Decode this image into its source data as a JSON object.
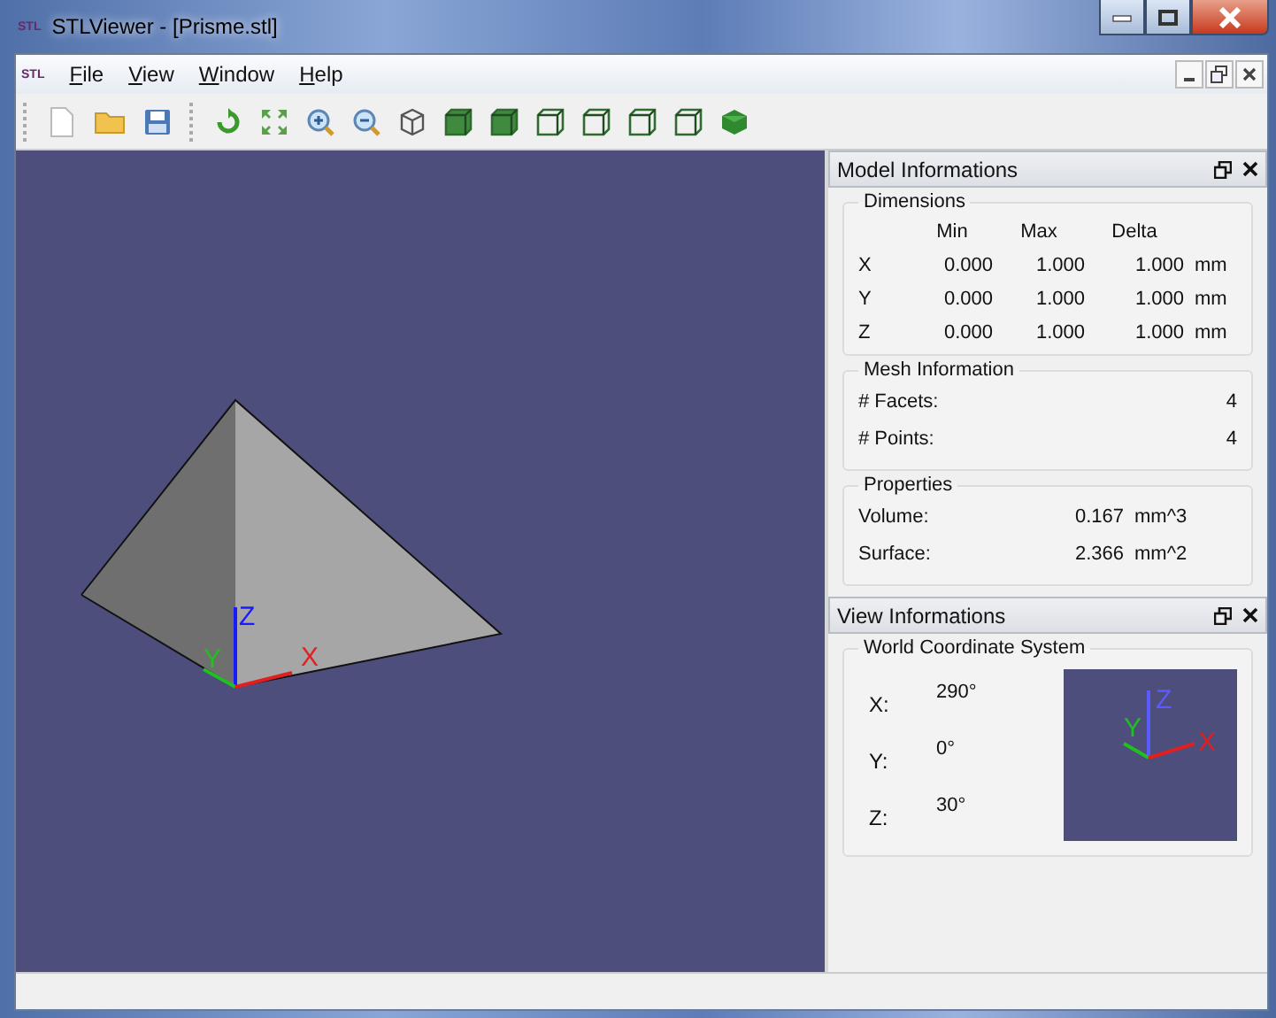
{
  "window": {
    "title": "STLViewer - [Prisme.stl]",
    "app_badge": "STL"
  },
  "menu": {
    "badge": "STL",
    "items": [
      {
        "label": "File"
      },
      {
        "label": "View"
      },
      {
        "label": "Window"
      },
      {
        "label": "Help"
      }
    ]
  },
  "viewport": {
    "axes": [
      {
        "kind": "z",
        "label": "Z",
        "color": "#1a1aff"
      },
      {
        "kind": "y",
        "label": "Y",
        "color": "#20c020"
      },
      {
        "kind": "x",
        "label": "X",
        "color": "#e02020"
      }
    ]
  },
  "model_panel": {
    "title": "Model Informations",
    "dimensions": {
      "title": "Dimensions",
      "columns": [
        "Min",
        "Max",
        "Delta"
      ],
      "rows": [
        {
          "axis": "X",
          "min": "0.000",
          "max": "1.000",
          "delta": "1.000",
          "unit": "mm"
        },
        {
          "axis": "Y",
          "min": "0.000",
          "max": "1.000",
          "delta": "1.000",
          "unit": "mm"
        },
        {
          "axis": "Z",
          "min": "0.000",
          "max": "1.000",
          "delta": "1.000",
          "unit": "mm"
        }
      ]
    },
    "mesh": {
      "title": "Mesh Information",
      "rows": [
        {
          "label": "# Facets:",
          "value": "4"
        },
        {
          "label": "# Points:",
          "value": "4"
        }
      ]
    },
    "properties": {
      "title": "Properties",
      "rows": [
        {
          "label": "Volume:",
          "value": "0.167",
          "unit": "mm^3"
        },
        {
          "label": "Surface:",
          "value": "2.366",
          "unit": "mm^2"
        }
      ]
    }
  },
  "view_panel": {
    "title": "View Informations",
    "group": "World Coordinate System",
    "rows": [
      {
        "label": "X:",
        "value": "290°"
      },
      {
        "label": "Y:",
        "value": "0°"
      },
      {
        "label": "Z:",
        "value": "30°"
      }
    ],
    "axes": [
      {
        "kind": "z",
        "label": "Z",
        "color": "#5a5aff"
      },
      {
        "kind": "y",
        "label": "Y",
        "color": "#20c020"
      },
      {
        "kind": "x",
        "label": "X",
        "color": "#e02020"
      }
    ]
  }
}
